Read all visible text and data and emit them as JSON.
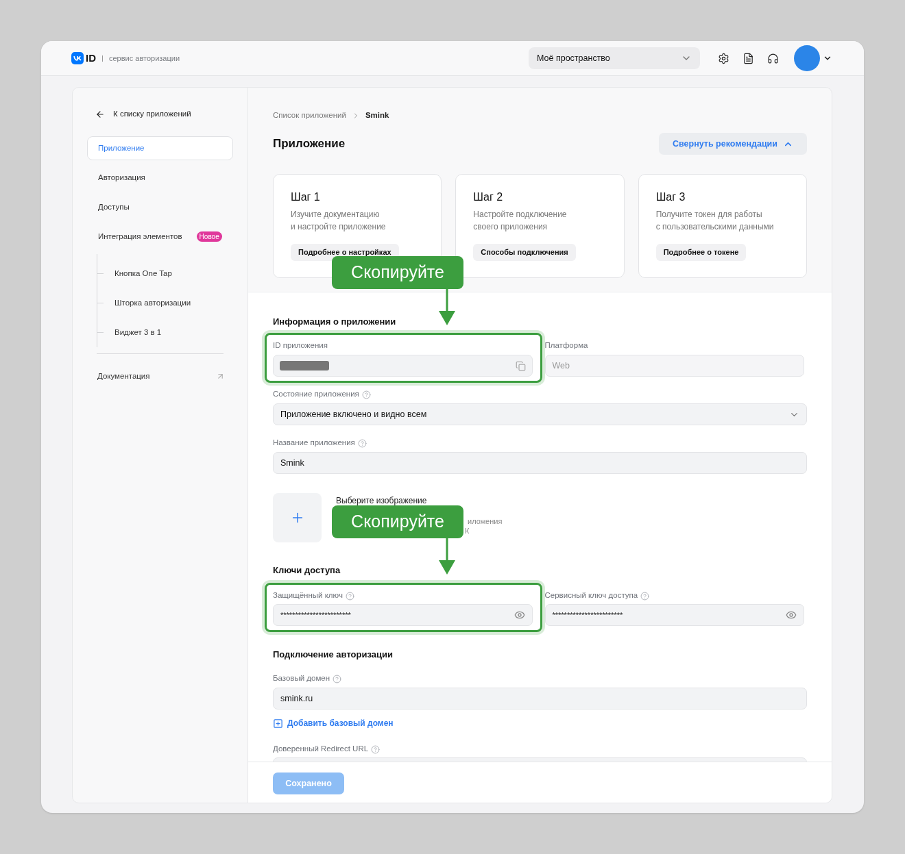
{
  "header": {
    "logo_text": "ID",
    "service": "сервис авторизации",
    "workspace": "Моё пространство"
  },
  "sidebar": {
    "back": "К списку приложений",
    "items": [
      {
        "label": "Приложение",
        "selected": true
      },
      {
        "label": "Авторизация",
        "selected": false
      },
      {
        "label": "Доступы",
        "selected": false
      },
      {
        "label": "Интеграция элементов",
        "selected": false,
        "badge": "Новое",
        "children": [
          {
            "label": "Кнопка One Tap",
            "selected": false
          },
          {
            "label": "Шторка авторизации",
            "selected": false
          },
          {
            "label": "Виджет 3 в 1",
            "selected": false
          }
        ]
      }
    ],
    "docs": "Документация"
  },
  "breadcrumb": [
    "Список приложений",
    "Smink"
  ],
  "title": "Приложение",
  "collapse_button": "Свернуть рекомендации",
  "steps": [
    {
      "title": "Шаг 1",
      "text": "Изучите документацию\nи настройте приложение",
      "button": "Подробнее о настройках"
    },
    {
      "title": "Шаг 2",
      "text": "Настройте подключение\nсвоего приложения",
      "button": "Способы подключения"
    },
    {
      "title": "Шаг 3",
      "text": "Получите токен для работы\nс пользовательскими данными",
      "button": "Подробнее о токене"
    }
  ],
  "info": {
    "heading": "Информация о приложении",
    "app_id": {
      "label": "ID приложения",
      "redacted": true
    },
    "platform": {
      "label": "Платформа",
      "value": "Web",
      "disabled": true
    },
    "state": {
      "label": "Состояние приложения",
      "value": "Приложение включено и видно всем"
    },
    "name": {
      "label": "Название приложения",
      "value": "Smink"
    },
    "image": {
      "lines": [
        "Выберите изображение",
        "иложения",
        "К"
      ]
    }
  },
  "keys": {
    "heading": "Ключи доступа",
    "fields": [
      {
        "label": "Защищённый ключ",
        "value": "************************"
      },
      {
        "label": "Сервисный ключ доступа",
        "value": "************************"
      }
    ]
  },
  "auth": {
    "heading": "Подключение авторизации",
    "domain": {
      "label": "Базовый домен",
      "value": "smink.ru"
    },
    "add_domain": "Добавить базовый домен",
    "redirect": {
      "label": "Доверенный Redirect URL"
    }
  },
  "save_button": {
    "label": "Сохранено",
    "disabled": true
  },
  "callouts": [
    {
      "text": "Скопируйте"
    },
    {
      "text": "Скопируйте"
    }
  ]
}
